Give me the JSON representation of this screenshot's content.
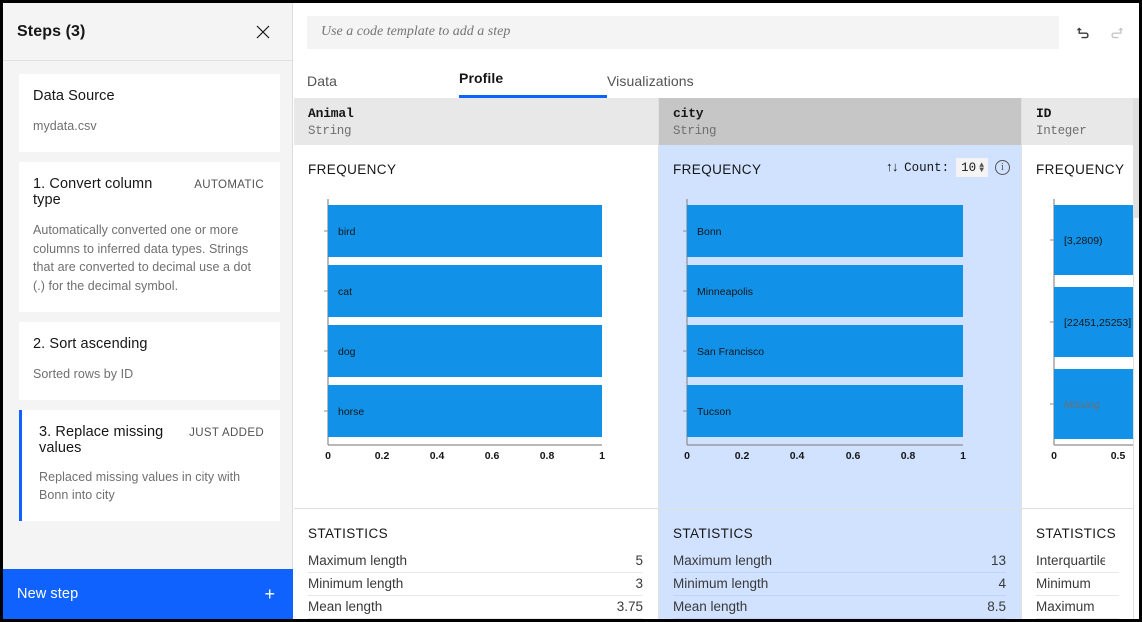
{
  "sidebar": {
    "title": "Steps (3)",
    "close_icon": "close-icon",
    "data_source": {
      "label": "Data Source",
      "value": "mydata.csv"
    },
    "steps": [
      {
        "title": "1. Convert column type",
        "tag": "AUTOMATIC",
        "desc": "Automatically converted one or more columns to inferred data types. Strings that are converted to decimal use a dot (.) for the decimal symbol."
      },
      {
        "title": "2. Sort ascending",
        "tag": "",
        "desc": "Sorted rows by ID"
      },
      {
        "title": "3. Replace missing values",
        "tag": "JUST ADDED",
        "desc": "Replaced missing values in city with Bonn into city"
      }
    ],
    "new_step": {
      "label": "New step",
      "plus": "+"
    }
  },
  "toolbar": {
    "code_placeholder": "Use a code template to add a step",
    "undo_icon": "undo-icon",
    "redo_icon": "redo-icon"
  },
  "tabs": [
    {
      "label": "Data",
      "active": false
    },
    {
      "label": "Profile",
      "active": true
    },
    {
      "label": "Visualizations",
      "active": false
    }
  ],
  "columns": [
    {
      "name": "Animal",
      "type": "String",
      "selected": false,
      "frequency_label": "FREQUENCY",
      "statistics_label": "STATISTICS",
      "statistics": [
        {
          "key": "Maximum length",
          "value": "5"
        },
        {
          "key": "Minimum length",
          "value": "3"
        },
        {
          "key": "Mean length",
          "value": "3.75"
        }
      ]
    },
    {
      "name": "city",
      "type": "String",
      "selected": true,
      "frequency_label": "FREQUENCY",
      "statistics_label": "STATISTICS",
      "count_control": {
        "sort_icon": "sort-arrows-icon",
        "label": "Count:",
        "value": "10",
        "info_icon": "info-icon"
      },
      "statistics": [
        {
          "key": "Maximum length",
          "value": "13"
        },
        {
          "key": "Minimum length",
          "value": "4"
        },
        {
          "key": "Mean length",
          "value": "8.5"
        }
      ]
    },
    {
      "name": "ID",
      "type": "Integer",
      "selected": false,
      "frequency_label": "FREQUENCY",
      "statistics_label": "STATISTICS",
      "statistics": [
        {
          "key": "Interquartile Ran",
          "value": ""
        },
        {
          "key": "Minimum",
          "value": ""
        },
        {
          "key": "Maximum",
          "value": ""
        }
      ]
    }
  ],
  "chart_data": [
    {
      "type": "bar",
      "orientation": "horizontal",
      "title": "FREQUENCY",
      "column": "Animal",
      "categories": [
        "bird",
        "cat",
        "dog",
        "horse"
      ],
      "values": [
        1,
        1,
        1,
        1
      ],
      "xlabel": "",
      "ylabel": "",
      "xlim": [
        0,
        1
      ],
      "xticks": [
        "0",
        "0.2",
        "0.4",
        "0.6",
        "0.8",
        "1"
      ],
      "grid": false,
      "bar_color": "#1192e8"
    },
    {
      "type": "bar",
      "orientation": "horizontal",
      "title": "FREQUENCY",
      "column": "city",
      "categories": [
        "Bonn",
        "Minneapolis",
        "San Francisco",
        "Tucson"
      ],
      "values": [
        1,
        1,
        1,
        1
      ],
      "xlabel": "",
      "ylabel": "",
      "xlim": [
        0,
        1
      ],
      "xticks": [
        "0",
        "0.2",
        "0.4",
        "0.6",
        "0.8",
        "1"
      ],
      "grid": false,
      "bar_color": "#1192e8"
    },
    {
      "type": "bar",
      "orientation": "horizontal",
      "title": "FREQUENCY",
      "column": "ID",
      "categories": [
        "[3,2809)",
        "[22451,25253]",
        "Missing"
      ],
      "values": [
        0.67,
        0.67,
        0.67
      ],
      "xlabel": "",
      "ylabel": "",
      "xlim": [
        0,
        0.67
      ],
      "xticks": [
        "0",
        "0.5"
      ],
      "grid": false,
      "bar_color": "#1192e8"
    }
  ]
}
